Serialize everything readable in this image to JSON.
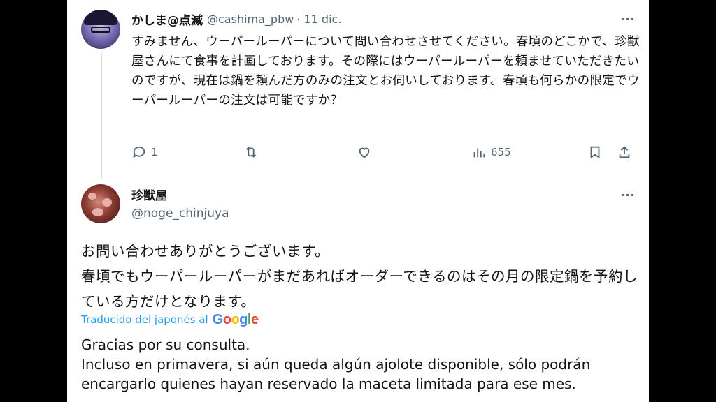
{
  "reply_tweet": {
    "display_name": "かしま@点滅",
    "handle": "@cashima_pbw",
    "date": "· 11 dic.",
    "text": "すみません、ウーパールーパーについて問い合わせさせてください。春頃のどこかで、珍獣屋さんにて食事を計画しております。その際にはウーパールーパーを頼ませていただきたいのですが、現在は鍋を頼んだ方のみの注文とお伺いしております。春頃も何らかの限定でウーパールーパーの注文は可能ですか？",
    "more_label": "···",
    "actions": {
      "reply_count": "1",
      "retweet_count": "",
      "like_count": "",
      "views_count": "655"
    }
  },
  "main_tweet": {
    "display_name": "珍獣屋",
    "handle": "@noge_chinjuya",
    "more_label": "···",
    "text_line1": "お問い合わせありがとうございます。",
    "text_line2": "春頃でもウーパールーパーがまだあればオーダーできるのはその月の限定鍋を予約している方だけとなります。",
    "translated_from": "Traducido del japonés al",
    "translator": "Google",
    "translation_line1": "Gracias por su consulta.",
    "translation_line2": "Incluso en primavera, si aún queda algún ajolote disponible, sólo podrán encargarlo quienes hayan reservado la maceta limitada para ese mes."
  },
  "icons": {
    "reply": "speech-bubble-icon",
    "retweet": "retweet-icon",
    "like": "heart-icon",
    "views": "bar-chart-icon",
    "bookmark": "bookmark-icon",
    "share": "share-icon",
    "more": "more-dots-icon"
  },
  "colors": {
    "link_blue": "#1d9bf0",
    "secondary_text": "#536471",
    "thread_line": "#cfd9de"
  }
}
